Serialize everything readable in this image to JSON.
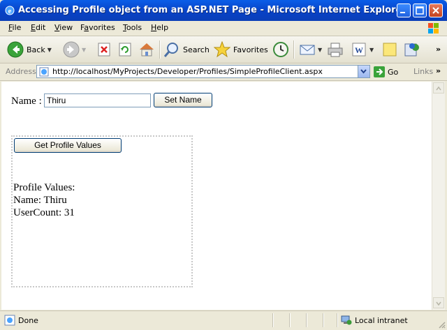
{
  "window": {
    "title": "Accessing Profile object from an ASP.NET Page - Microsoft Internet Explorer",
    "buttons": [
      "minimize-icon",
      "maximize-icon",
      "close-icon"
    ]
  },
  "menu": {
    "items": [
      {
        "pre": "",
        "ul": "F",
        "post": "ile"
      },
      {
        "pre": "",
        "ul": "E",
        "post": "dit"
      },
      {
        "pre": "",
        "ul": "V",
        "post": "iew"
      },
      {
        "pre": "F",
        "ul": "a",
        "post": "vorites"
      },
      {
        "pre": "",
        "ul": "T",
        "post": "ools"
      },
      {
        "pre": "",
        "ul": "H",
        "post": "elp"
      }
    ]
  },
  "toolbar": {
    "back_label": "Back",
    "search_label": "Search",
    "favorites_label": "Favorites"
  },
  "address": {
    "label": "Address",
    "url": "http://localhost/MyProjects/Developer/Profiles/SimpleProfileClient.aspx",
    "go_label": "Go",
    "links_label": "Links"
  },
  "page": {
    "name_label": "Name :",
    "name_value": "Thiru",
    "set_name_button": "Set Name",
    "get_values_button": "Get Profile Values",
    "output": {
      "heading": "Profile Values:",
      "name_line": "Name: Thiru",
      "usercount_line": "UserCount: 31"
    }
  },
  "status": {
    "text": "Done",
    "zone": "Local intranet"
  },
  "colors": {
    "titlebar": "#0a5ee8",
    "chrome": "#ece9d8",
    "button_border": "#003c74"
  }
}
